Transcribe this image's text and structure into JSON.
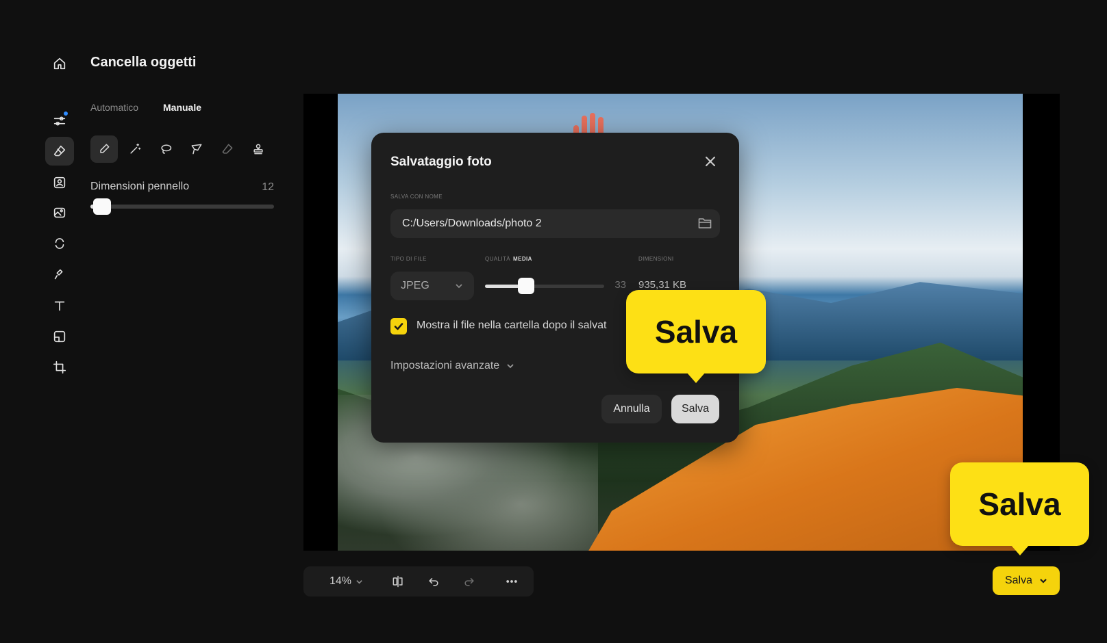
{
  "panel": {
    "title": "Cancella oggetti",
    "tabs": [
      {
        "label": "Automatico",
        "active": false
      },
      {
        "label": "Manuale",
        "active": true
      }
    ],
    "brush_size_label": "Dimensioni pennello",
    "brush_size_value": "12",
    "brush_size_fraction": 0.06
  },
  "rail_icons": [
    "home-icon",
    "adjustments-icon",
    "eraser-icon",
    "portrait-icon",
    "photo-enhance-icon",
    "replace-icon",
    "sparkle-icon",
    "text-icon",
    "layout-icon",
    "crop-icon"
  ],
  "tools": [
    "brush-icon",
    "magic-wand-icon",
    "lasso-icon",
    "polygon-lasso-icon",
    "eraser-icon",
    "stamp-icon"
  ],
  "dialog": {
    "title": "Salvataggio foto",
    "filename_caption": "SALVA CON NOME",
    "filename_value": "C:/Users/Downloads/photo 2",
    "filetype_caption": "TIPO DI FILE",
    "filetype_value": "JPEG",
    "quality_caption": "QUALITÀ",
    "quality_level": "MEDIA",
    "quality_value": "33",
    "quality_fraction": 0.33,
    "size_caption": "DIMENSIONI",
    "size_value": "935,31 KB",
    "show_in_folder_label": "Mostra il file nella cartella dopo il salvat",
    "show_in_folder_checked": true,
    "advanced_label": "Impostazioni avanzate",
    "cancel_label": "Annulla",
    "save_label": "Salva"
  },
  "callouts": {
    "dialog_save": "Salva",
    "main_save": "Salva"
  },
  "bottom_bar": {
    "zoom": "14%"
  },
  "save_button": {
    "label": "Salva"
  },
  "colors": {
    "accent": "#f5d30c",
    "callout": "#fde015",
    "background": "#101010"
  }
}
